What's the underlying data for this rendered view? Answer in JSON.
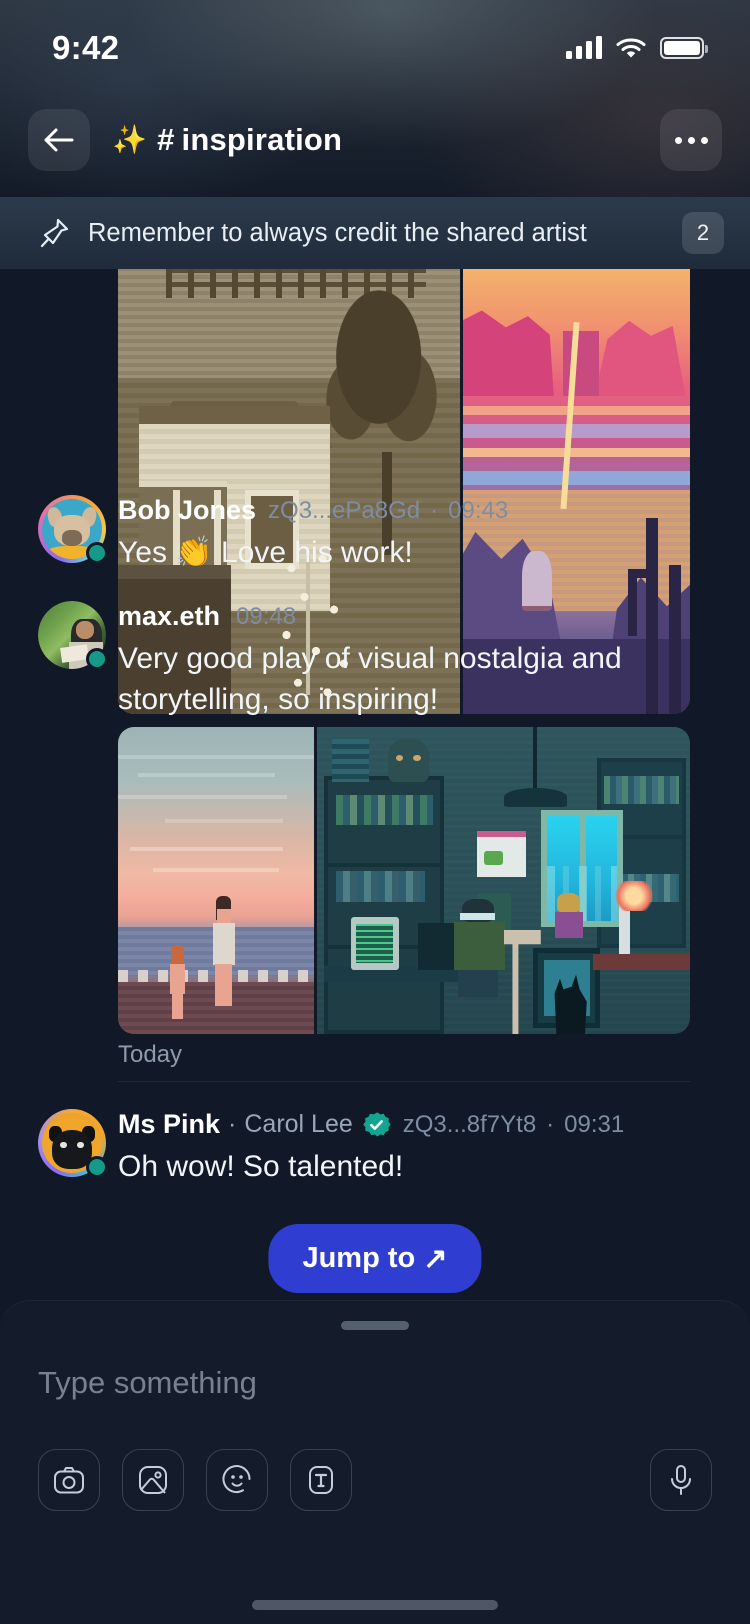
{
  "status_bar": {
    "time": "9:42",
    "signal_icon": "cellular-signal-icon",
    "wifi_icon": "wifi-icon",
    "battery_icon": "battery-full-icon"
  },
  "header": {
    "back_icon": "back-arrow-icon",
    "emoji": "✨",
    "hash": "#",
    "channel": "inspiration",
    "more_icon": "more-options-icon"
  },
  "pinned": {
    "icon": "pin-icon",
    "text": "Remember to always credit the shared artist",
    "count": "2"
  },
  "messages": [
    {
      "id": "msg-attachment-top",
      "type": "attachment-grid",
      "images": [
        {
          "name": "pixel-art-farmhouse",
          "alt": "Sepia pixel art of a farmhouse with porch, fence and blossoming tree"
        },
        {
          "name": "pixel-art-desert-sunset",
          "alt": "Pink and purple pixel art desert canyon at sunset with cactus"
        }
      ]
    },
    {
      "id": "msg-bob-jones",
      "author": "Bob Jones",
      "handle": "zQ3...ePa8Gd",
      "separator": "·",
      "time": "09:43",
      "text": "Yes 👏 Love his work!",
      "avatar": "bob-jones-avatar",
      "online": true,
      "ringed": true
    },
    {
      "id": "msg-max-eth",
      "author": "max.eth",
      "handle": "",
      "time": "09:48",
      "text": "Very good play of visual nostalgia and storytelling, so inspiring!",
      "avatar": "max-eth-avatar",
      "online": true,
      "ringed": false,
      "images": [
        {
          "name": "pixel-art-beach-sunset",
          "alt": "Pixel art of a parent and child walking on a beach at sunset"
        },
        {
          "name": "pixel-art-cozy-study",
          "alt": "Teal pixel art interior of a cozy study with bookshelves, desk, window and cat"
        }
      ]
    }
  ],
  "day_divider": {
    "label": "Today"
  },
  "message_today": {
    "id": "msg-ms-pink",
    "author": "Ms Pink",
    "separator": "·",
    "real_name": "Carol Lee",
    "verified_icon": "verified-badge-icon",
    "handle": "zQ3...8f7Yt8",
    "time_separator": "·",
    "time": "09:31",
    "text": "Oh wow! So talented!",
    "avatar": "ms-pink-avatar"
  },
  "jump_button": {
    "label": "Jump to",
    "arrow": "↗"
  },
  "composer": {
    "placeholder": "Type something",
    "grabber": "drag-handle",
    "tools": [
      {
        "name": "camera-icon",
        "label": "Camera"
      },
      {
        "name": "image-icon",
        "label": "Photo library"
      },
      {
        "name": "sticker-icon",
        "label": "Stickers"
      },
      {
        "name": "text-format-icon",
        "label": "Text formatting"
      }
    ],
    "mic": {
      "name": "microphone-icon",
      "label": "Voice message"
    }
  },
  "colors": {
    "background": "#111827",
    "composer_bg": "#141c2b",
    "accent_blue": "#2f3ed0",
    "online_green": "#159a8a",
    "verified_teal": "#13a58f",
    "muted_text": "#7e8ea2"
  }
}
